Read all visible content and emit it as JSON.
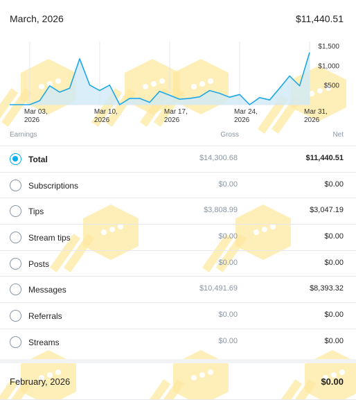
{
  "current_month": {
    "title": "March, 2026",
    "total": "$11,440.51"
  },
  "chart_data": {
    "type": "area",
    "series": [
      {
        "values": [
          0,
          0,
          0,
          100,
          480,
          320,
          420,
          1170,
          500,
          360,
          500,
          0,
          160,
          160,
          60,
          340,
          240,
          140,
          160,
          200,
          360,
          290,
          190,
          260,
          0,
          180,
          120,
          420,
          730,
          480,
          1330
        ]
      }
    ],
    "x_ticks": [
      {
        "label": [
          "Mar 03,",
          "2026"
        ],
        "day": 3
      },
      {
        "label": [
          "Mar 10,",
          "2026"
        ],
        "day": 10
      },
      {
        "label": [
          "Mar 17,",
          "2026"
        ],
        "day": 17
      },
      {
        "label": [
          "Mar 24,",
          "2026"
        ],
        "day": 24
      },
      {
        "label": [
          "Mar 31,",
          "2026"
        ],
        "day": 31
      }
    ],
    "y_ticks": [
      {
        "label": "$1,500",
        "value": 1500
      },
      {
        "label": "$1,000",
        "value": 1000
      },
      {
        "label": "$500",
        "value": 500
      }
    ],
    "ylim": [
      0,
      1500
    ],
    "grid": "vertical",
    "colors": {
      "line": "#1ea7e6",
      "fill": "#cfeaf8",
      "grid": "#e3e6ea"
    }
  },
  "columns": {
    "earnings": "Earnings",
    "gross": "Gross",
    "net": "Net"
  },
  "rows": [
    {
      "label": "Total",
      "gross": "$14,300.68",
      "net": "$11,440.51",
      "selected": true
    },
    {
      "label": "Subscriptions",
      "gross": "$0.00",
      "net": "$0.00",
      "selected": false
    },
    {
      "label": "Tips",
      "gross": "$3,808.99",
      "net": "$3,047.19",
      "selected": false
    },
    {
      "label": "Stream tips",
      "gross": "$0.00",
      "net": "$0.00",
      "selected": false
    },
    {
      "label": "Posts",
      "gross": "$0.00",
      "net": "$0.00",
      "selected": false
    },
    {
      "label": "Messages",
      "gross": "$10,491.69",
      "net": "$8,393.32",
      "selected": false
    },
    {
      "label": "Referrals",
      "gross": "$0.00",
      "net": "$0.00",
      "selected": false
    },
    {
      "label": "Streams",
      "gross": "$0.00",
      "net": "$0.00",
      "selected": false
    }
  ],
  "next_month": {
    "title": "February, 2026",
    "total": "$0.00"
  },
  "colors": {
    "accent": "#00aff0",
    "muted": "#8a96a3",
    "watermark": "#fde8a0"
  }
}
